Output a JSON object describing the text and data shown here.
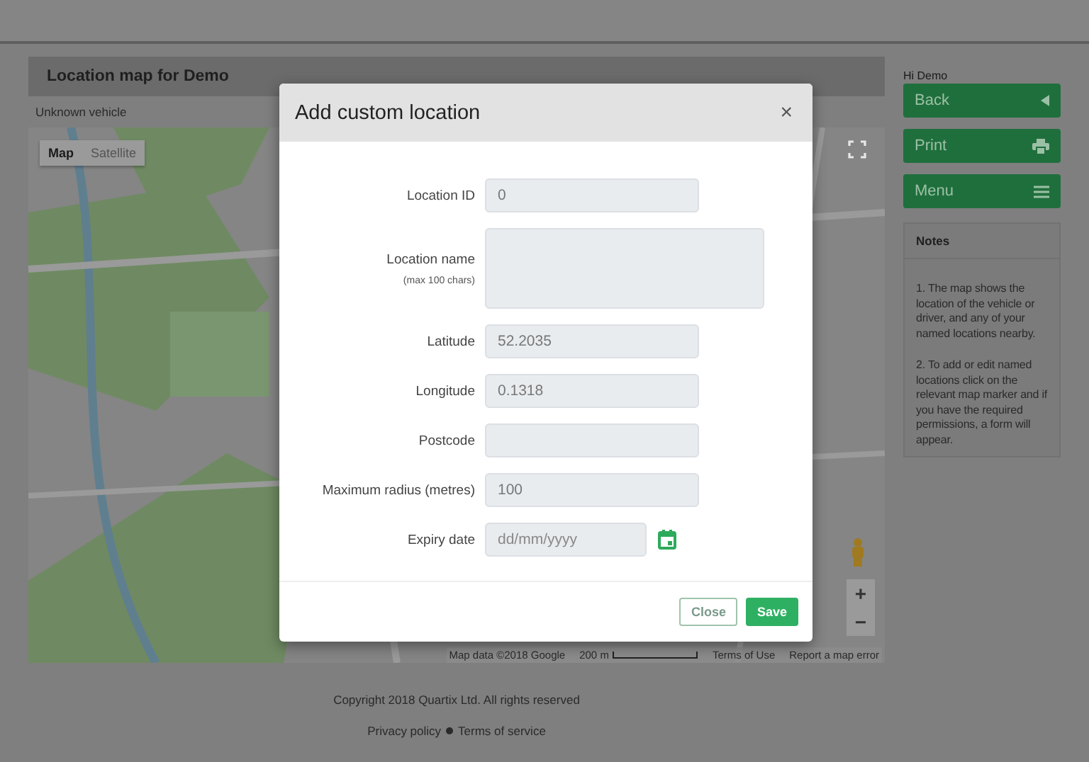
{
  "page": {
    "title": "Location map for Demo",
    "subtitle": "Unknown vehicle"
  },
  "map": {
    "map_types": [
      {
        "label": "Map",
        "selected": true
      },
      {
        "label": "Satellite",
        "selected": false
      }
    ],
    "zoom_in": "+",
    "zoom_out": "−",
    "attribution": [
      "Map data ©2018 Google",
      "200 m",
      "Terms of Use",
      "Report a map error"
    ]
  },
  "sidebar": {
    "greeting": "Hi Demo",
    "buttons": [
      {
        "label": "Back",
        "kind": "back"
      },
      {
        "label": "Print",
        "kind": "print"
      },
      {
        "label": "Menu",
        "kind": "menu"
      }
    ],
    "notes": {
      "title": "Notes",
      "items": [
        "1. The map shows the location of the vehicle or driver, and any of your named locations nearby.",
        "2. To add or edit named locations click on the relevant map marker and if you have the required permissions, a form will appear."
      ]
    }
  },
  "footer": {
    "copyright": "Copyright 2018 Quartix Ltd. All rights reserved",
    "links": [
      "Privacy policy",
      "Terms of service"
    ]
  },
  "dialog": {
    "title": "Add custom location",
    "close": "×",
    "fields": [
      {
        "label": "Location ID",
        "kind": "text",
        "value": "0"
      },
      {
        "label": "Location name",
        "hint": "(max 100 chars)",
        "kind": "textarea"
      },
      {
        "label": "Latitude",
        "kind": "text",
        "value": "52.2035"
      },
      {
        "label": "Longitude",
        "kind": "text",
        "value": "0.1318"
      },
      {
        "label": "Postcode",
        "kind": "text"
      },
      {
        "label": "Maximum radius (metres)",
        "kind": "text",
        "value": "100"
      },
      {
        "label": "Expiry date",
        "kind": "date",
        "placeholder": "dd/mm/yyyy"
      }
    ],
    "buttons": [
      {
        "label": "Close",
        "kind": "secondary"
      },
      {
        "label": "Save",
        "kind": "primary"
      }
    ]
  }
}
